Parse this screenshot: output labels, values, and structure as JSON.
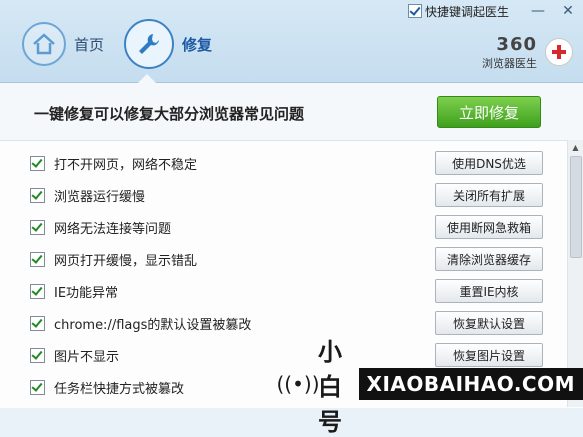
{
  "titlebar": {
    "hotkey_label": "快捷键调起医生",
    "minimize_glyph": "—",
    "close_glyph": "✕"
  },
  "nav": {
    "home_label": "首页",
    "repair_label": "修复"
  },
  "brand": {
    "number": "360",
    "subtitle": "浏览器医生"
  },
  "main": {
    "headline": "一键修复可以修复大部分浏览器常见问题",
    "fix_all_label": "立即修复"
  },
  "items": [
    {
      "label": "打不开网页，网络不稳定",
      "action": "使用DNS优选"
    },
    {
      "label": "浏览器运行缓慢",
      "action": "关闭所有扩展"
    },
    {
      "label": "网络无法连接等问题",
      "action": "使用断网急救箱"
    },
    {
      "label": "网页打开缓慢，显示错乱",
      "action": "清除浏览器缓存"
    },
    {
      "label": "IE功能异常",
      "action": "重置IE内核"
    },
    {
      "label": "chrome://flags的默认设置被篡改",
      "action": "恢复默认设置"
    },
    {
      "label": "图片不显示",
      "action": "恢复图片设置"
    },
    {
      "label": "任务栏快捷方式被篡改",
      "action": ""
    }
  ],
  "watermark": {
    "name": "小白号",
    "domain": "XIAOBAIHAO.COM"
  },
  "icons": [
    "home-icon",
    "wrench-icon",
    "medical-kit-icon",
    "signal-icon",
    "checkbox-icon"
  ],
  "colors": {
    "accent_green": "#3ea01d",
    "header_blue": "#c5ddef",
    "active_blue": "#1c5aa6",
    "cross_red": "#d8272d"
  }
}
